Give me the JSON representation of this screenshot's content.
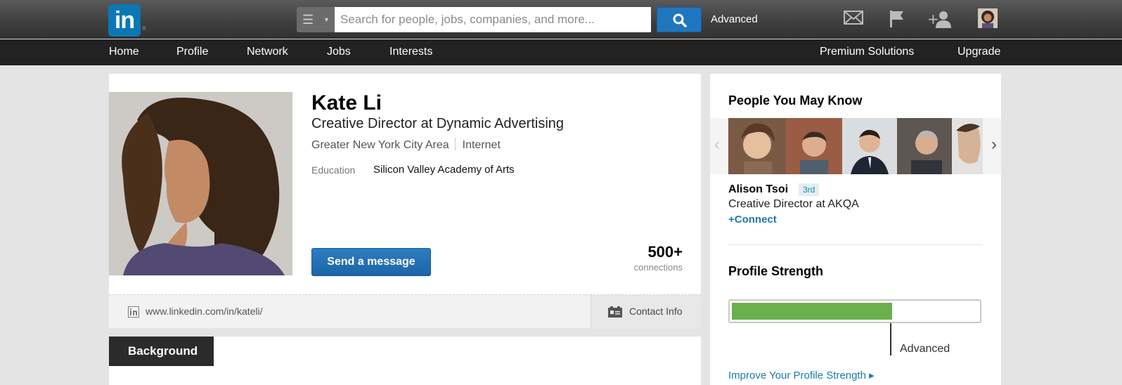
{
  "topbar": {
    "logo_text": "in",
    "logo_registered": "®",
    "search_placeholder": "Search for people, jobs, companies, and more...",
    "advanced_label": "Advanced",
    "icons": [
      "menu-icon",
      "search-icon",
      "mail-icon",
      "flag-icon",
      "add-connection-icon",
      "user-avatar"
    ],
    "accent_color": "#0a78b4"
  },
  "nav": {
    "left": [
      "Home",
      "Profile",
      "Network",
      "Jobs",
      "Interests"
    ],
    "premium": "Premium Solutions",
    "upgrade": "Upgrade"
  },
  "profile": {
    "name": "Kate Li",
    "headline": "Creative Director at Dynamic Advertising",
    "location": "Greater New York City Area",
    "industry": "Internet",
    "education_label": "Education",
    "education_value": "Silicon Valley Academy of Arts",
    "send_message": "Send a message",
    "connections_count": "500+",
    "connections_label": "connections",
    "public_url": "www.linkedin.com/in/kateli/",
    "contact_info": "Contact Info"
  },
  "background": {
    "tab_label": "Background"
  },
  "pymk": {
    "title": "People You May Know",
    "person_name": "Alison Tsoi",
    "degree": "3rd",
    "person_title": "Creative Director at AKQA",
    "connect": "+Connect"
  },
  "profile_strength": {
    "title": "Profile Strength",
    "level": "Advanced",
    "fill_fraction": 0.65,
    "fill_color": "#6ab04c",
    "improve_link": "Improve Your Profile Strength ▸"
  }
}
